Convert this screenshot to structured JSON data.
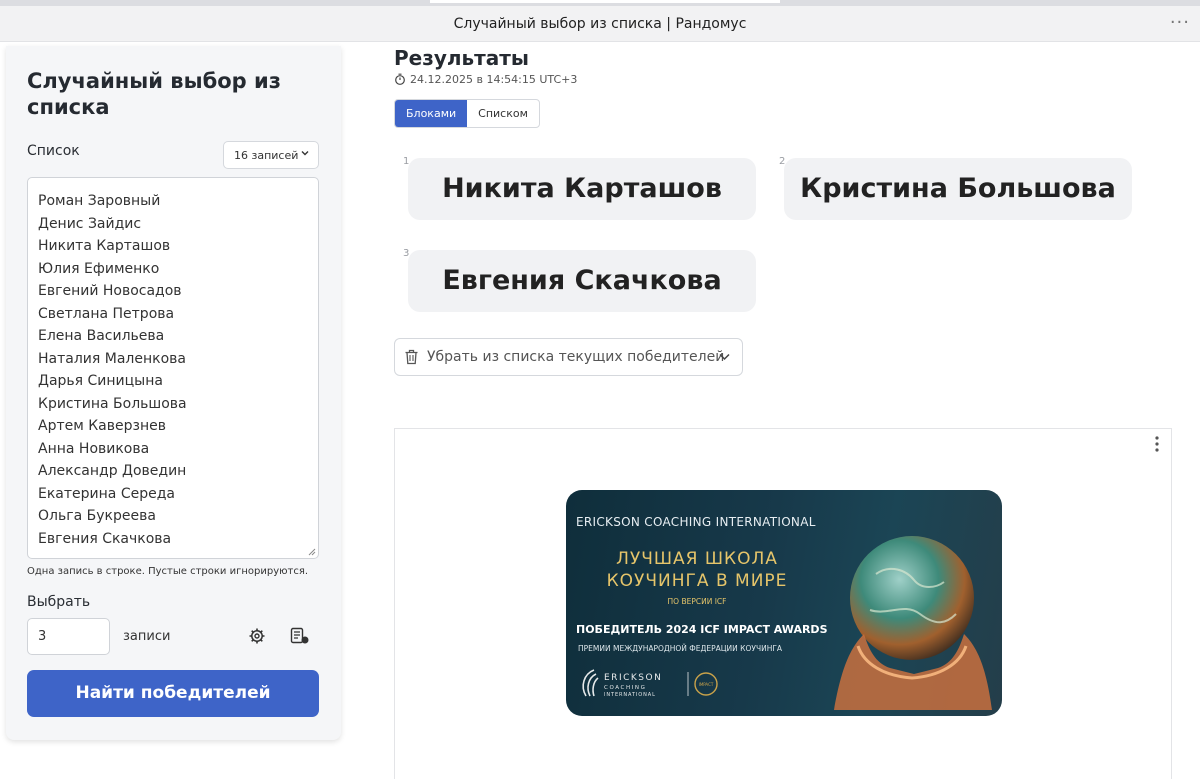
{
  "window": {
    "title": "Случайный выбор из списка | Рандомус",
    "menu_glyph": "···"
  },
  "sidebar": {
    "title": "Случайный выбор из списка",
    "list_label": "Список",
    "count_select": "16 записей",
    "names": [
      "Роман Заровный",
      "Денис Зайдис",
      "Никита Карташов",
      "Юлия Ефименко",
      "Евгений Новосадов",
      "Светлана Петрова",
      "Елена Васильева",
      "Наталия Маленкова",
      "Дарья Синицына",
      "Кристина Большова",
      "Артем Каверзнев",
      "Анна Новикова",
      "Александр Доведин",
      "Екатерина Середа",
      "Ольга Букреева",
      "Евгения Скачкова"
    ],
    "hint": "Одна запись в строке. Пустые строки игнорируются.",
    "pick_label": "Выбрать",
    "pick_value": "3",
    "records_label": "записи",
    "find_button": "Найти победителей"
  },
  "results": {
    "title": "Результаты",
    "timestamp": "24.12.2025 в 14:54:15 UTC+3",
    "view_tabs": [
      "Блоками",
      "Списком"
    ],
    "active_tab": "Блоками",
    "winners": [
      {
        "index": "1",
        "name": "Никита Карташов"
      },
      {
        "index": "2",
        "name": "Кристина Большова"
      },
      {
        "index": "3",
        "name": "Евгения Скачкова"
      }
    ],
    "remove_button": "Убрать из списка текущих победителей"
  },
  "ad": {
    "heading": "ERICKSON COACHING INTERNATIONAL",
    "line1": "ЛУЧШАЯ ШКОЛА",
    "line2": "КОУЧИНГА В МИРЕ",
    "sub": "ПО ВЕРСИИ ICF",
    "winner": "ПОБЕДИТЕЛЬ 2024 ICF IMPACT AWARDS",
    "federation": "ПРЕМИИ МЕЖДУНАРОДНОЙ ФЕДЕРАЦИИ КОУЧИНГА",
    "logo_lettering": "ERICKSON COACHING INTERNATIONAL",
    "colors": {
      "gold": "#e6c56a",
      "background": "#17394a"
    }
  },
  "colors": {
    "accent": "#3e64c8",
    "card_bg": "#f1f2f4",
    "panel_bg": "#f5f6f8"
  }
}
